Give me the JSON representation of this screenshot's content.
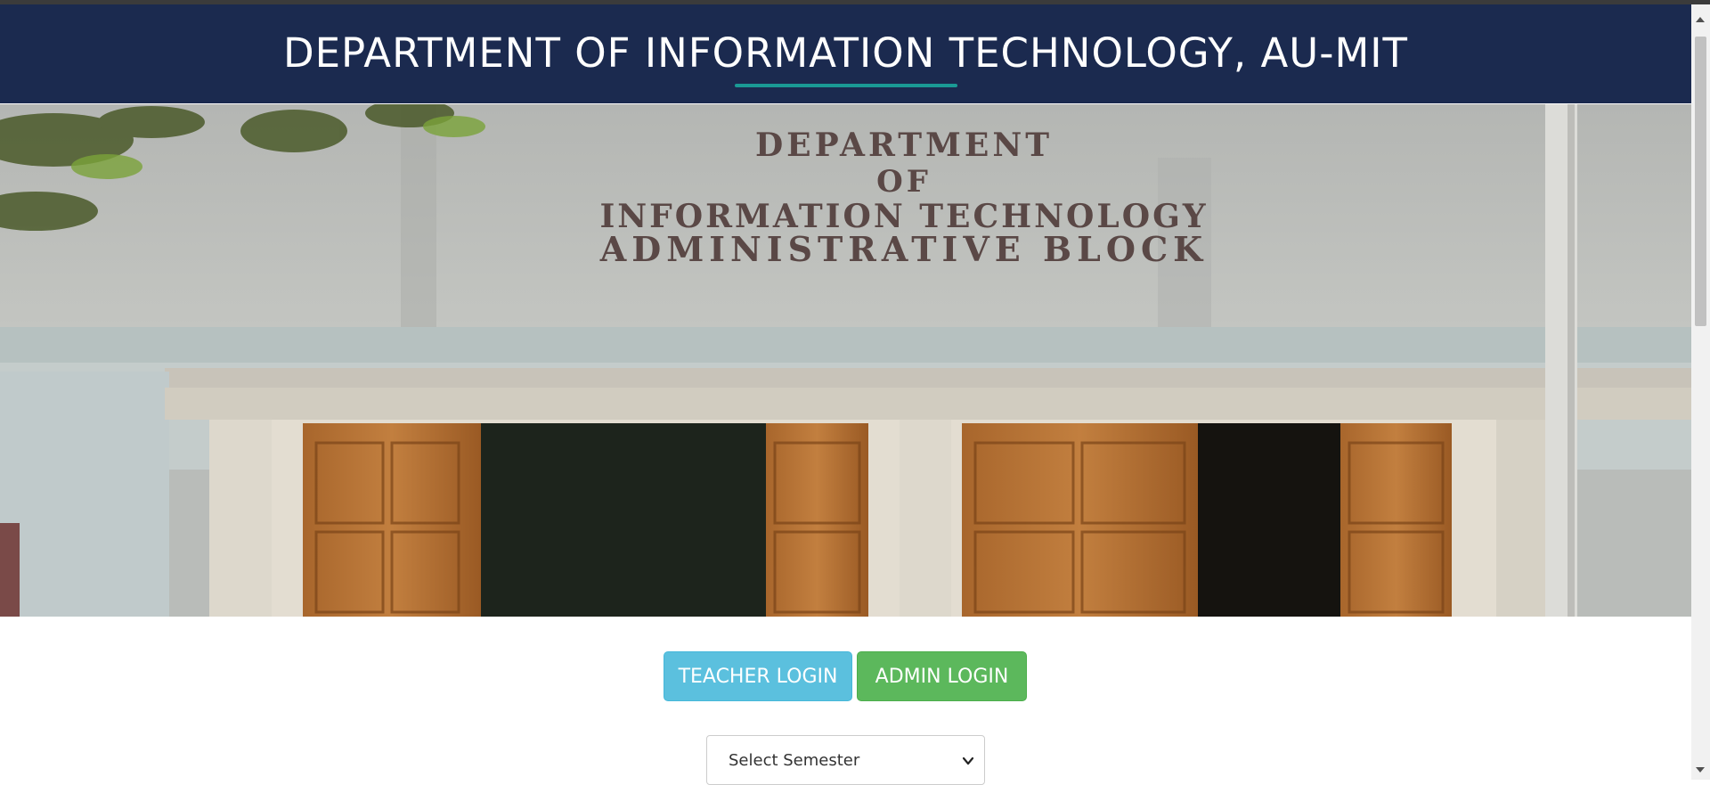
{
  "header": {
    "title": "DEPARTMENT OF INFORMATION TECHNOLOGY, AU-MIT",
    "accent_color": "#1a9a95",
    "background_color": "#1b2a4f"
  },
  "carousel": {
    "sign_lines": [
      "DEPARTMENT",
      "OF",
      "INFORMATION TECHNOLOGY",
      "ADMINISTRATIVE  BLOCK"
    ],
    "slide_count": 4,
    "active_slide": 1
  },
  "buttons": {
    "teacher_label": "TEACHER LOGIN",
    "admin_label": "ADMIN LOGIN"
  },
  "semester_select": {
    "selected": "Select Semester",
    "icon": "chevron-down-icon"
  }
}
